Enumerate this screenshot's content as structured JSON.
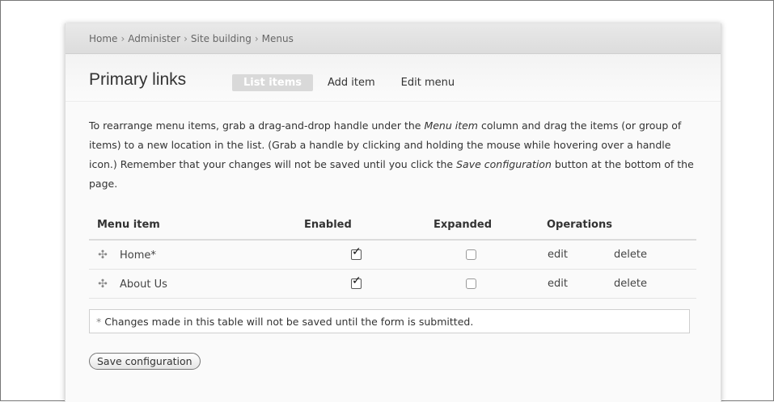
{
  "breadcrumb": [
    "Home",
    "Administer",
    "Site building",
    "Menus"
  ],
  "breadcrumb_separator": "›",
  "page_title": "Primary links",
  "tabs": [
    {
      "label": "List items",
      "active": true
    },
    {
      "label": "Add item",
      "active": false
    },
    {
      "label": "Edit menu",
      "active": false
    }
  ],
  "help": {
    "t1": "To rearrange menu items, grab a drag-and-drop handle under the ",
    "em1": "Menu item",
    "t2": " column and drag the items (or group of items) to a new location in the list. (Grab a handle by clicking and holding the mouse while hovering over a handle icon.) Remember that your changes will not be saved until you click the ",
    "em2": "Save configuration",
    "t3": " button at the bottom of the page."
  },
  "table": {
    "headers": {
      "menu_item": "Menu item",
      "enabled": "Enabled",
      "expanded": "Expanded",
      "operations": "Operations"
    },
    "rows": [
      {
        "label": "Home*",
        "enabled": true,
        "expanded": false,
        "edit": "edit",
        "delete": "delete"
      },
      {
        "label": "About Us",
        "enabled": true,
        "expanded": false,
        "edit": "edit",
        "delete": "delete"
      }
    ]
  },
  "drag_handle_glyph": "✣",
  "warning": {
    "asterisk": "*",
    "text": "Changes made in this table will not be saved until the form is submitted."
  },
  "save_button": "Save configuration"
}
